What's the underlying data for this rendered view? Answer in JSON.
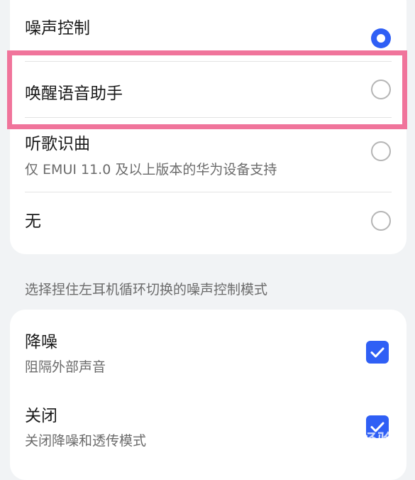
{
  "mode_options": [
    {
      "title": "噪声控制",
      "subtitle": "",
      "selected": true
    },
    {
      "title": "唤醒语音助手",
      "subtitle": "",
      "selected": false
    },
    {
      "title": "听歌识曲",
      "subtitle": "仅 EMUI 11.0 及以上版本的华为设备支持",
      "selected": false
    },
    {
      "title": "无",
      "subtitle": "",
      "selected": false
    }
  ],
  "cycle_section_label": "选择捏住左耳机循环切换的噪声控制模式",
  "cycle_options": [
    {
      "title": "降噪",
      "subtitle": "阻隔外部声音",
      "checked": true
    },
    {
      "title": "关闭",
      "subtitle": "关闭降噪和透传模式",
      "checked": true
    }
  ],
  "colors": {
    "accent": "#2f5ff5",
    "highlight": "#f0749b"
  },
  "watermark": {
    "text": "Baidu经验",
    "url": "jingyan.baidu.com"
  }
}
